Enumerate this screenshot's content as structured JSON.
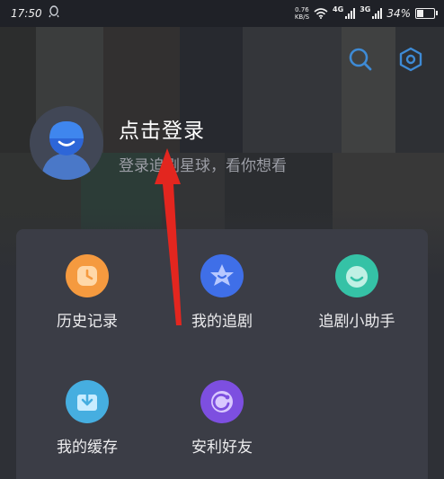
{
  "status_bar": {
    "time": "17:50",
    "net_speed_value": "0.76",
    "net_speed_unit": "KB/S",
    "signal_1_label": "4G",
    "signal_2_label": "3G",
    "battery_text": "34%",
    "battery_level": 0.34
  },
  "header": {
    "search_icon": "search-icon",
    "settings_icon": "hexagon-settings-icon",
    "accent_color": "#3e8bd6"
  },
  "profile": {
    "login_title": "点击登录",
    "login_subtitle": "登录追剧星球，看你想看"
  },
  "menu": {
    "items": [
      {
        "label": "历史记录",
        "icon": "history-clock-icon",
        "color": "#f59a3f"
      },
      {
        "label": "我的追剧",
        "icon": "star-follow-icon",
        "color": "#3f6fe8"
      },
      {
        "label": "追剧小助手",
        "icon": "assistant-smile-icon",
        "color": "#35c2a6"
      },
      {
        "label": "我的缓存",
        "icon": "download-cache-icon",
        "color": "#46aee0"
      },
      {
        "label": "安利好友",
        "icon": "share-friend-icon",
        "color": "#7d4fe0"
      }
    ]
  },
  "annotation": {
    "arrow_color": "#e3261f"
  }
}
